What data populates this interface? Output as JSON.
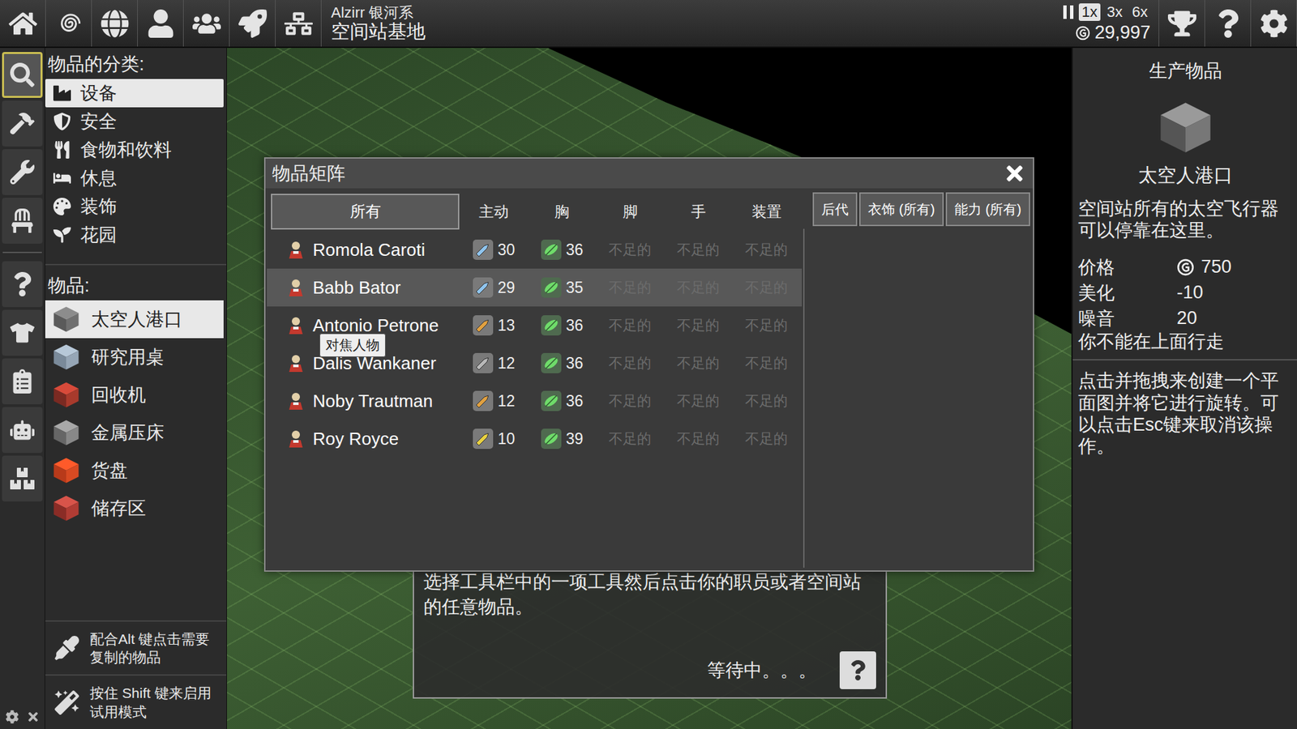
{
  "top_bar": {
    "galaxy": "Alzirr 银河系",
    "location": "空间站基地",
    "speeds": [
      {
        "label": "1x",
        "selected": true
      },
      {
        "label": "3x",
        "selected": false
      },
      {
        "label": "6x",
        "selected": false
      }
    ],
    "money": "29,997"
  },
  "tool_rail": {
    "tools": [
      {
        "selected": true
      },
      {
        "selected": false
      },
      {
        "selected": false
      },
      {
        "selected": false
      },
      {
        "selected": false
      },
      {
        "selected": false
      },
      {
        "selected": false
      },
      {
        "selected": false
      },
      {
        "selected": false
      }
    ]
  },
  "category_panel": {
    "categories_header": "物品的分类:",
    "categories": [
      {
        "label": "设备",
        "selected": true
      },
      {
        "label": "安全",
        "selected": false
      },
      {
        "label": "食物和饮料",
        "selected": false
      },
      {
        "label": "休息",
        "selected": false
      },
      {
        "label": "装饰",
        "selected": false
      },
      {
        "label": "花园",
        "selected": false
      }
    ],
    "items_header": "物品:",
    "items": [
      {
        "label": "太空人港口",
        "selected": true
      },
      {
        "label": "研究用桌",
        "selected": false
      },
      {
        "label": "回收机",
        "selected": false
      },
      {
        "label": "金属压床",
        "selected": false
      },
      {
        "label": "货盘",
        "selected": false
      },
      {
        "label": "储存区",
        "selected": false
      }
    ],
    "hints": [
      "配合Alt 键点击需要复制的物品",
      "按住 Shift 键来启用试用模式"
    ]
  },
  "matrix_window": {
    "title": "物品矩阵",
    "tabs": [
      {
        "label": "所有",
        "selected": true
      }
    ],
    "columns": [
      "主动",
      "胸",
      "脚",
      "手",
      "装置"
    ],
    "filters": [
      "后代",
      "衣饰 (所有)",
      "能力 (所有)"
    ],
    "tooltip": "对焦人物",
    "rows": [
      {
        "name": "Romola Caroti",
        "selected": false,
        "active": "30",
        "tool_color": "#8fc4ee",
        "chest": "36",
        "cells": [
          {
            "text": "不足的",
            "missing": true
          },
          {
            "text": "不足的",
            "missing": true
          },
          {
            "text": "不足的",
            "missing": true
          }
        ]
      },
      {
        "name": "Babb Bator",
        "selected": true,
        "active": "29",
        "tool_color": "#8fc4ee",
        "chest": "35",
        "cells": [
          {
            "text": "不足的",
            "missing": true
          },
          {
            "text": "不足的",
            "missing": true
          },
          {
            "text": "不足的",
            "missing": true
          }
        ]
      },
      {
        "name": "Antonio Petrone",
        "selected": false,
        "active": "13",
        "tool_color": "#e0a040",
        "chest": "36",
        "cells": [
          {
            "text": "不足的",
            "missing": true
          },
          {
            "text": "不足的",
            "missing": true
          },
          {
            "text": "不足的",
            "missing": true
          }
        ]
      },
      {
        "name": "Dalis Wankaner",
        "selected": false,
        "active": "12",
        "tool_color": "#b8b8b8",
        "chest": "36",
        "cells": [
          {
            "text": "不足的",
            "missing": true
          },
          {
            "text": "不足的",
            "missing": true
          },
          {
            "text": "不足的",
            "missing": true
          }
        ]
      },
      {
        "name": "Noby Trautman",
        "selected": false,
        "active": "12",
        "tool_color": "#e0a040",
        "chest": "36",
        "cells": [
          {
            "text": "不足的",
            "missing": true
          },
          {
            "text": "不足的",
            "missing": true
          },
          {
            "text": "不足的",
            "missing": true
          }
        ]
      },
      {
        "name": "Roy Royce",
        "selected": false,
        "active": "10",
        "tool_color": "#e8d040",
        "chest": "39",
        "cells": [
          {
            "text": "不足的",
            "missing": true
          },
          {
            "text": "不足的",
            "missing": true
          },
          {
            "text": "不足的",
            "missing": true
          }
        ]
      }
    ]
  },
  "tutorial": {
    "text": "选择工具栏中的一项工具然后点击你的职员或者空间站的任意物品。",
    "status": "等待中。。。"
  },
  "detail_panel": {
    "header": "生产物品",
    "name": "太空人港口",
    "description": "空间站所有的太空飞行器可以停靠在这里。",
    "stats": [
      {
        "label": "价格",
        "value": "750",
        "currency": true
      },
      {
        "label": "美化",
        "value": "-10",
        "currency": false
      },
      {
        "label": "噪音",
        "value": "20",
        "currency": false
      }
    ],
    "note": "你不能在上面行走",
    "help": "点击并拖拽来创建一个平面图并将它进行旋转。可以点击Esc键来取消该操作。"
  }
}
